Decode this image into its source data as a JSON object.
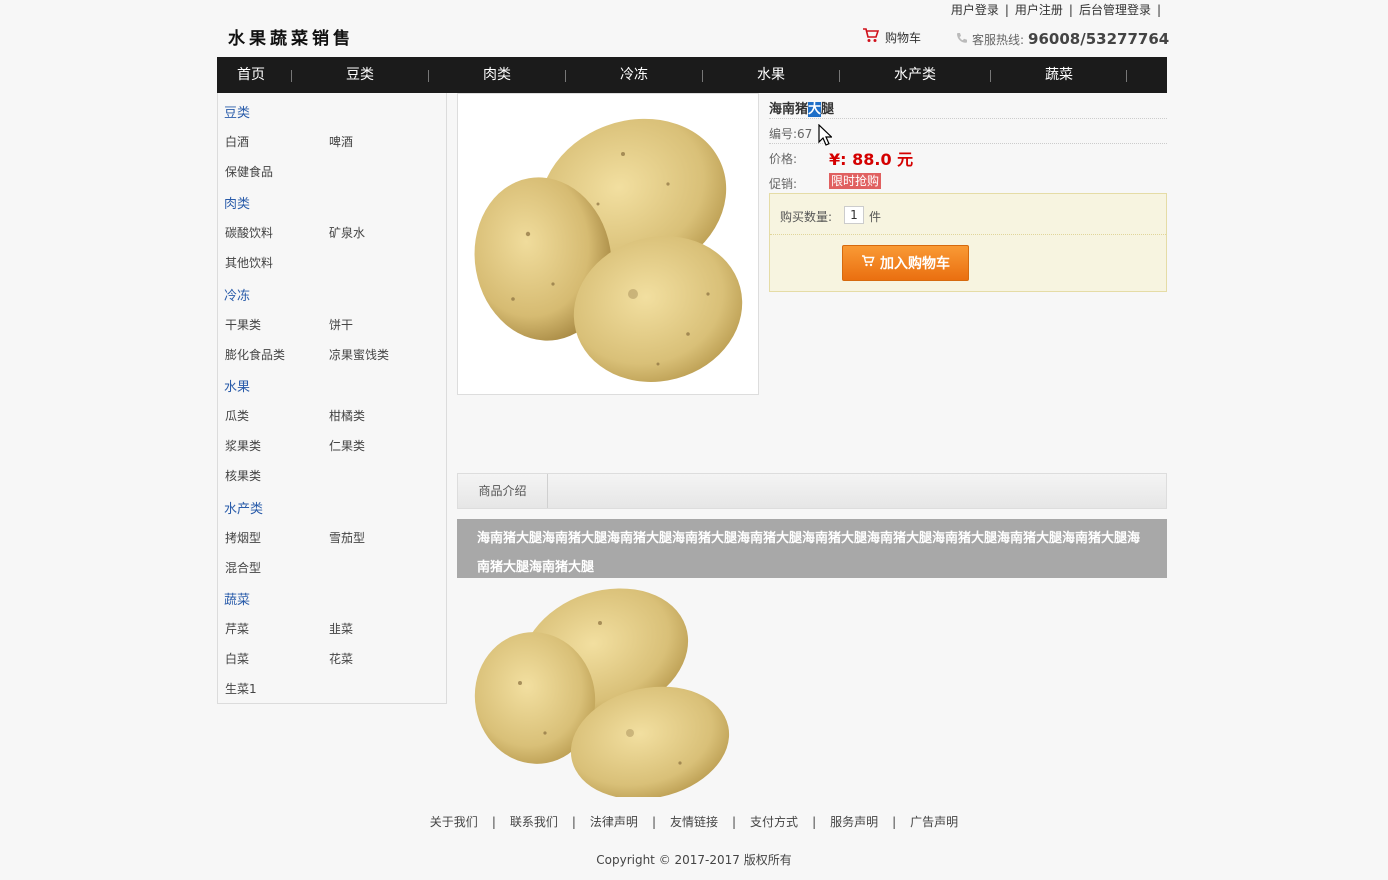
{
  "top_links": [
    "用户登录",
    "用户注册",
    "后台管理登录"
  ],
  "top_links_sep": "|",
  "logo_text": "水果蔬菜销售",
  "cart_label": "购物车",
  "hotline_label": "客服热线:",
  "hotline_number": "96008/53277764",
  "nav": [
    "首页",
    "豆类",
    "肉类",
    "冷冻",
    "水果",
    "水产类",
    "蔬菜"
  ],
  "nav_sep": "|",
  "sidebar": [
    {
      "category": "豆类",
      "items": [
        "白酒",
        "啤酒",
        "保健食品"
      ]
    },
    {
      "category": "肉类",
      "items": [
        "碳酸饮料",
        "矿泉水",
        "其他饮料"
      ]
    },
    {
      "category": "冷冻",
      "items": [
        "干果类",
        "饼干",
        "膨化食品类",
        "凉果蜜饯类"
      ]
    },
    {
      "category": "水果",
      "items": [
        "瓜类",
        "柑橘类",
        "浆果类",
        "仁果类",
        "核果类"
      ]
    },
    {
      "category": "水产类",
      "items": [
        "拷烟型",
        "雪茄型",
        "混合型"
      ]
    },
    {
      "category": "蔬菜",
      "items": [
        "芹菜",
        "韭菜",
        "白菜",
        "花菜",
        "生菜1"
      ]
    }
  ],
  "product": {
    "title_before": "海南猪",
    "title_highlight": "大",
    "title_after": "腿",
    "code_label": "编号:",
    "code_value": "67",
    "price_label": "价格:",
    "price": "¥: 88.0 元",
    "promo_label": "促销:",
    "promo_badge": "限时抢购",
    "qty_label": "购买数量:",
    "qty_value": "1",
    "qty_unit": "件",
    "add_to_cart": "加入购物车"
  },
  "tab_label": "商品介绍",
  "description": "海南猪大腿海南猪大腿海南猪大腿海南猪大腿海南猪大腿海南猪大腿海南猪大腿海南猪大腿海南猪大腿海南猪大腿海南猪大腿海南猪大腿",
  "footer_links": [
    "关于我们",
    "联系我们",
    "法律声明",
    "友情链接",
    "支付方式",
    "服务声明",
    "广告声明"
  ],
  "footer_sep": "|",
  "copyright": "Copyright © 2017-2017 版权所有",
  "colors": {
    "nav_bg": "#1b1b1b",
    "category": "#2a5caa",
    "price": "#d40000",
    "button": "#ea6f10",
    "promo": "#e06060"
  }
}
